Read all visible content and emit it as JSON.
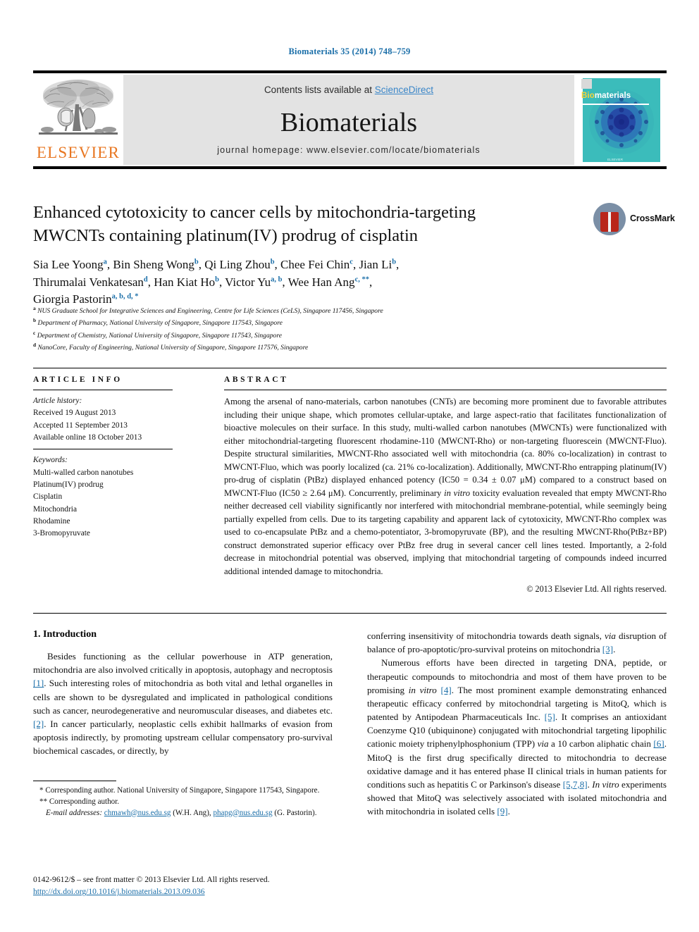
{
  "running_head": "Biomaterials 35 (2014) 748–759",
  "masthead": {
    "contents_prefix": "Contents lists available at ",
    "sciencedirect": "ScienceDirect",
    "journal_title": "Biomaterials",
    "homepage": "journal homepage: www.elsevier.com/locate/biomaterials",
    "publisher_logo_text": "ELSEVIER",
    "cover": {
      "title_first": "Bio",
      "title_rest": "materials",
      "footer": "ELSEVIER"
    }
  },
  "article": {
    "title_line1": "Enhanced cytotoxicity to cancer cells by mitochondria-targeting",
    "title_line2": "MWCNTs containing platinum(IV) prodrug of cisplatin",
    "crossmark_label": "CrossMark",
    "authors": [
      {
        "name": "Sia Lee Yoong",
        "marks": "a",
        "sep": ", "
      },
      {
        "name": "Bin Sheng Wong",
        "marks": "b",
        "sep": ", "
      },
      {
        "name": "Qi Ling Zhou",
        "marks": "b",
        "sep": ", "
      },
      {
        "name": "Chee Fei Chin",
        "marks": "c",
        "sep": ", "
      },
      {
        "name": "Jian Li",
        "marks": "b",
        "sep": ", "
      },
      {
        "name": "Thirumalai Venkatesan",
        "marks": "d",
        "sep": ", "
      },
      {
        "name": "Han Kiat Ho",
        "marks": "b",
        "sep": ", "
      },
      {
        "name": "Victor Yu",
        "marks": "a, b",
        "sep": ", "
      },
      {
        "name": "Wee Han Ang",
        "marks": "c, **",
        "sep": ", "
      },
      {
        "name": "Giorgia Pastorin",
        "marks": "a, b, d, *",
        "sep": ""
      }
    ],
    "affiliations": [
      {
        "mark": "a",
        "text": "NUS Graduate School for Integrative Sciences and Engineering, Centre for Life Sciences (CeLS), Singapore 117456, Singapore"
      },
      {
        "mark": "b",
        "text": "Department of Pharmacy, National University of Singapore, Singapore 117543, Singapore"
      },
      {
        "mark": "c",
        "text": "Department of Chemistry, National University of Singapore, Singapore 117543, Singapore"
      },
      {
        "mark": "d",
        "text": "NanoCore, Faculty of Engineering, National University of Singapore, Singapore 117576, Singapore"
      }
    ]
  },
  "article_info": {
    "heading": "ARTICLE INFO",
    "history_label": "Article history:",
    "history": [
      "Received 19 August 2013",
      "Accepted 11 September 2013",
      "Available online 18 October 2013"
    ],
    "keywords_label": "Keywords:",
    "keywords": [
      "Multi-walled carbon nanotubes",
      "Platinum(IV) prodrug",
      "Cisplatin",
      "Mitochondria",
      "Rhodamine",
      "3-Bromopyruvate"
    ]
  },
  "abstract": {
    "heading": "ABSTRACT",
    "text": "Among the arsenal of nano-materials, carbon nanotubes (CNTs) are becoming more prominent due to favorable attributes including their unique shape, which promotes cellular-uptake, and large aspect-ratio that facilitates functionalization of bioactive molecules on their surface. In this study, multi-walled carbon nanotubes (MWCNTs) were functionalized with either mitochondrial-targeting fluorescent rhodamine-110 (MWCNT-Rho) or non-targeting fluorescein (MWCNT-Fluo). Despite structural similarities, MWCNT-Rho associated well with mitochondria (ca. 80% co-localization) in contrast to MWCNT-Fluo, which was poorly localized (ca. 21% co-localization). Additionally, MWCNT-Rho entrapping platinum(IV) pro-drug of cisplatin (PtBz) displayed enhanced potency (IC50 = 0.34 ± 0.07 μM) compared to a construct based on MWCNT-Fluo (IC50 ≥ 2.64 μM). Concurrently, preliminary ",
    "italic1": "in vitro",
    "text2": " toxicity evaluation revealed that empty MWCNT-Rho neither decreased cell viability significantly nor interfered with mitochondrial membrane-potential, while seemingly being partially expelled from cells. Due to its targeting capability and apparent lack of cytotoxicity, MWCNT-Rho complex was used to co-encapsulate PtBz and a chemo-potentiator, 3-bromopyruvate (BP), and the resulting MWCNT-Rho(PtBz+BP) construct demonstrated superior efficacy over PtBz free drug in several cancer cell lines tested. Importantly, a 2-fold decrease in mitochondrial potential was observed, implying that mitochondrial targeting of compounds indeed incurred additional intended damage to mitochondria.",
    "copyright": "© 2013 Elsevier Ltd. All rights reserved."
  },
  "introduction": {
    "heading": "1. Introduction",
    "left_para1_a": "Besides functioning as the cellular powerhouse in ATP generation, mitochondria are also involved critically in apoptosis, autophagy and necroptosis ",
    "left_ref1": "[1]",
    "left_para1_b": ". Such interesting roles of mitochondria as both vital and lethal organelles in cells are shown to be dysregulated and implicated in pathological conditions such as cancer, neurodegenerative and neuromuscular diseases, and diabetes etc. ",
    "left_ref2": "[2]",
    "left_para1_c": ". In cancer particularly, neoplastic cells exhibit hallmarks of evasion from apoptosis indirectly, by promoting upstream cellular compensatory pro-survival biochemical cascades, or directly, by",
    "right_para1_a": "conferring insensitivity of mitochondria towards death signals, ",
    "right_ital1": "via",
    "right_para1_b": " disruption of balance of pro-apoptotic/pro-survival proteins on mitochondria ",
    "right_ref3": "[3]",
    "right_para1_c": ".",
    "right_para2_a": "Numerous efforts have been directed in targeting DNA, peptide, or therapeutic compounds to mitochondria and most of them have proven to be promising ",
    "right_ital2": "in vitro",
    "right_para2_b": " ",
    "right_ref4": "[4]",
    "right_para2_c": ". The most prominent example demonstrating enhanced therapeutic efficacy conferred by mitochondrial targeting is MitoQ, which is patented by Antipodean Pharmaceuticals Inc. ",
    "right_ref5": "[5]",
    "right_para2_d": ". It comprises an antioxidant Coenzyme Q10 (ubiquinone) conjugated with mitochondrial targeting lipophilic cationic moiety triphenylphosphonium (TPP) ",
    "right_ital3": "via",
    "right_para2_e": " a 10 carbon aliphatic chain ",
    "right_ref6": "[6]",
    "right_para2_f": ". MitoQ is the first drug specifically directed to mitochondria to decrease oxidative damage and it has entered phase II clinical trials in human patients for conditions such as hepatitis C or Parkinson's disease ",
    "right_ref7": "[5,7,8]",
    "right_para2_g": ". ",
    "right_ital4": "In vitro",
    "right_para2_h": " experiments showed that MitoQ was selectively associated with isolated mitochondria and with mitochondria in isolated cells ",
    "right_ref9": "[9]",
    "right_para2_i": "."
  },
  "footnotes": {
    "fn1_mark": "*",
    "fn1_text": " Corresponding author. National University of Singapore, Singapore 117543, Singapore.",
    "fn2_mark": "**",
    "fn2_text": " Corresponding author.",
    "email_label": "E-mail addresses:",
    "email1": "chmawh@nus.edu.sg",
    "email1_owner": "(W.H. Ang),",
    "email2": "phapg@nus.edu.sg",
    "email2_owner": "(G. Pastorin).",
    "issn_line": "0142-9612/$ – see front matter © 2013 Elsevier Ltd. All rights reserved.",
    "doi": "http://dx.doi.org/10.1016/j.biomaterials.2013.09.036"
  }
}
